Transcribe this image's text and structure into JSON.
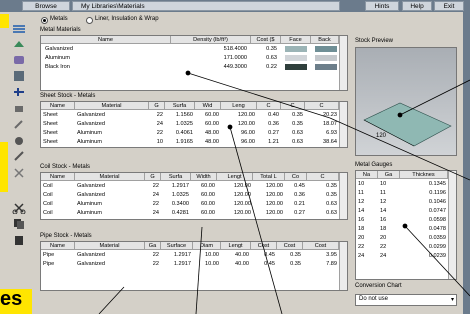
{
  "toolbar": {
    "browse": "Browse",
    "path": "My Libraries\\Materials",
    "hints": "Hints",
    "help": "Help",
    "exit": "Exit"
  },
  "mode": {
    "metals": "Metals",
    "liner": "Liner, Insulation & Wrap",
    "selected": "metals"
  },
  "metal_materials": {
    "title": "Metal Materials",
    "columns": [
      "Name",
      "Density (lb/ft³)",
      "Cost ($",
      "Face",
      "Back"
    ],
    "rows": [
      {
        "name": "Galvanized",
        "density": "518.4000",
        "cost": "0.35",
        "face": "#9bb4b6",
        "back": "#6f8f96"
      },
      {
        "name": "Aluminum",
        "density": "171.0000",
        "cost": "0.63",
        "face": "#d0d4d8",
        "back": "#c4c8cc"
      },
      {
        "name": "Black Iron",
        "density": "449.3000",
        "cost": "0.22",
        "face": "#2f3f3c",
        "back": "#6c7e8a"
      }
    ]
  },
  "sheet_stock": {
    "title": "Sheet Stock - Metals",
    "columns": [
      "Name",
      "Material",
      "G",
      "Surfa",
      "Wid",
      "Leng",
      "C",
      "C",
      "C"
    ],
    "rows": [
      [
        "Sheet",
        "Galvanized",
        "22",
        "1.1560",
        "60.00",
        "120.00",
        "0.40",
        "0.35",
        "20.23"
      ],
      [
        "Sheet",
        "Galvanized",
        "24",
        "1.0325",
        "60.00",
        "120.00",
        "0.36",
        "0.35",
        "18.07"
      ],
      [
        "Sheet",
        "Aluminum",
        "22",
        "0.4061",
        "48.00",
        "96.00",
        "0.27",
        "0.63",
        "6.93"
      ],
      [
        "Sheet",
        "Aluminum",
        "10",
        "1.9165",
        "48.00",
        "96.00",
        "1.21",
        "0.63",
        "38.64"
      ]
    ]
  },
  "coil_stock": {
    "title": "Coil Stock - Metals",
    "columns": [
      "Name",
      "Material",
      "G",
      "Surfa",
      "Width",
      "Lengt",
      "Total L",
      "Co",
      "C"
    ],
    "rows": [
      [
        "Coil",
        "Galvanized",
        "22",
        "1.2917",
        "60.00",
        "120.00",
        "120.00",
        "0.45",
        "0.35"
      ],
      [
        "Coil",
        "Galvanized",
        "24",
        "1.0325",
        "60.00",
        "120.00",
        "120.00",
        "0.36",
        "0.35"
      ],
      [
        "Coil",
        "Aluminum",
        "22",
        "0.3400",
        "60.00",
        "120.00",
        "120.00",
        "0.21",
        "0.63"
      ],
      [
        "Coil",
        "Aluminum",
        "24",
        "0.4281",
        "60.00",
        "120.00",
        "120.00",
        "0.27",
        "0.63"
      ]
    ]
  },
  "pipe_stock": {
    "title": "Pipe Stock - Metals",
    "columns": [
      "Name",
      "Material",
      "Ga",
      "Surface",
      "Diam",
      "Lengt",
      "Cost",
      "Cost",
      "Cost"
    ],
    "rows": [
      [
        "Pipe",
        "Galvanized",
        "22",
        "1.2917",
        "10.00",
        "40.00",
        "0.45",
        "0.35",
        "3.95"
      ],
      [
        "Pipe",
        "Galvanized",
        "22",
        "1.2917",
        "10.00",
        "40.00",
        "0.45",
        "0.35",
        "7.89"
      ]
    ]
  },
  "preview": {
    "title": "Stock Preview",
    "dimension": "120"
  },
  "metal_gauges": {
    "title": "Metal Gauges",
    "columns": [
      "Na",
      "Ga",
      "Thicknes"
    ],
    "rows": [
      [
        "10",
        "10",
        "0.1345"
      ],
      [
        "11",
        "11",
        "0.1196"
      ],
      [
        "12",
        "12",
        "0.1046"
      ],
      [
        "14",
        "14",
        "0.0747"
      ],
      [
        "16",
        "16",
        "0.0598"
      ],
      [
        "18",
        "18",
        "0.0478"
      ],
      [
        "20",
        "20",
        "0.0359"
      ],
      [
        "22",
        "22",
        "0.0299"
      ],
      [
        "24",
        "24",
        "0.0239"
      ]
    ]
  },
  "conversion": {
    "title": "Conversion Chart",
    "value": "Do not use"
  },
  "overlay_text": "es"
}
